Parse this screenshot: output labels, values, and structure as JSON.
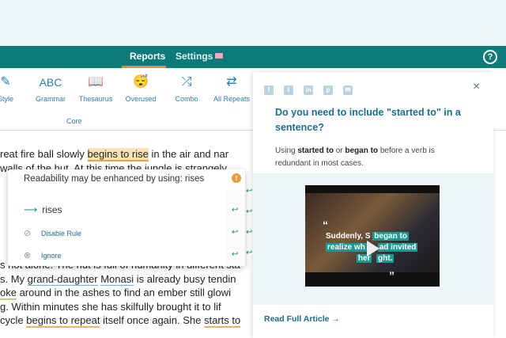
{
  "nav": {
    "tab_reports": "Reports",
    "tab_settings": "Settings",
    "help_icon": "?"
  },
  "toolbar": {
    "group_label": "Core",
    "items": [
      {
        "label": "Style",
        "icon": "pencil-icon",
        "glyph": "✎"
      },
      {
        "label": "Grammar",
        "icon": "abc-icon",
        "glyph": "ABC"
      },
      {
        "label": "Thesaurus",
        "icon": "book-icon",
        "glyph": "📖"
      },
      {
        "label": "Overused",
        "icon": "sleepy-face-icon",
        "glyph": "😴"
      },
      {
        "label": "Combo",
        "icon": "shuffle-icon",
        "glyph": "⤮"
      },
      {
        "label": "All Repeats",
        "icon": "repeat-icon",
        "glyph": "⇄"
      }
    ]
  },
  "editor": {
    "line1_a": "reat fire ball slowly ",
    "line1_hl": "begins to rise",
    "line1_b": " in the air and nar",
    "line2": "walls of the hut. At this time the jungle is strangely",
    "line9_a": "s not alone. The hut is full of humanity in different sta",
    "line10_a": "s. My ",
    "line10_u1": "grand-daughter",
    "line10_sp": " ",
    "line10_u2": "Monasi",
    "line10_b": " is already busy tendin",
    "line11_u": "oke",
    "line11_b": " around in the ashes to find an ember still glowi",
    "line12": "g. Within minutes she has skilfully brought it to lif",
    "line13_a": "cycle ",
    "line13_u": "begins to repeat",
    "line13_b": " itself once again. She ",
    "line13_u2": "starts to"
  },
  "popup": {
    "message": "Readability may be enhanced by using: rises",
    "warn_icon": "!",
    "suggestion": "rises",
    "disable_rule": "Disable Rule",
    "ignore": "Ignore"
  },
  "sidebar": {
    "share_icons": [
      "f",
      "t",
      "in",
      "p",
      "✉"
    ],
    "close_icon": "×",
    "title": "Do you need to include \"started to\" in a sentence?",
    "body_1": "Using ",
    "body_b1": "started to",
    "body_2": " or ",
    "body_b2": "began to",
    "body_3": " before a verb is redundant in most cases.",
    "video_caption_1": "Suddenly, S",
    "video_caption_hl": "began to",
    "video_caption_2": "realize wh",
    "video_caption_3": "ad invited",
    "video_caption_4": "her",
    "video_caption_5": "ght.",
    "read_full": "Read Full Article →"
  },
  "colors": {
    "nav_bg": "#0b7a78",
    "accent_blue": "#1f6c8c",
    "highlight": "#fbe2b5",
    "warn": "#e89b3a"
  }
}
